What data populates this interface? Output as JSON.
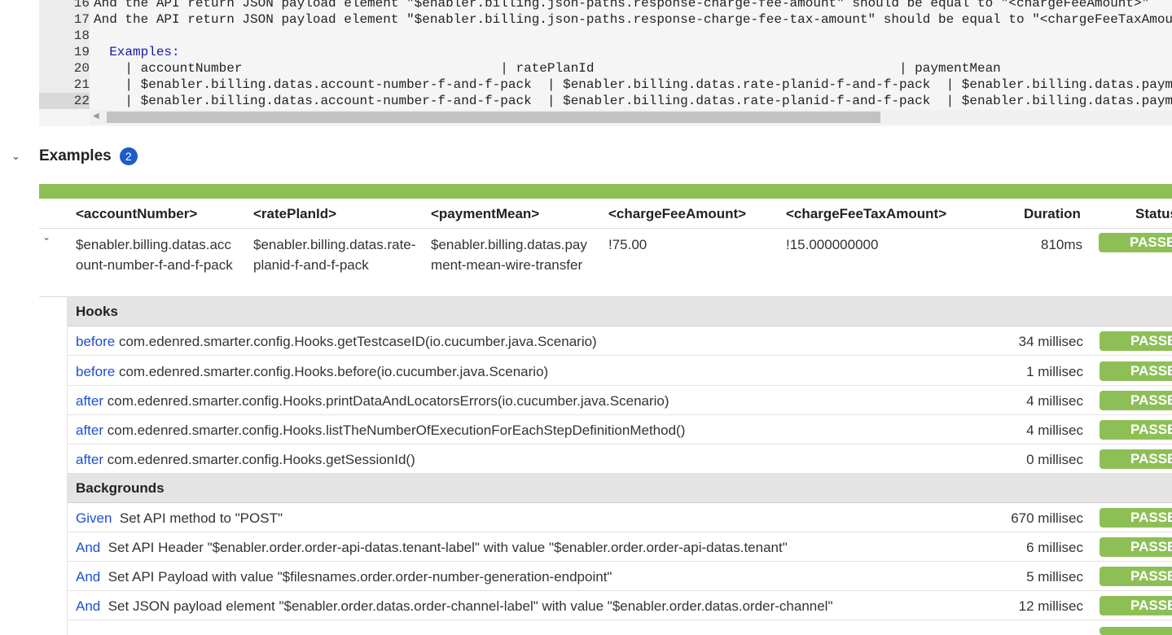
{
  "code": {
    "lines": [
      {
        "num": "16",
        "text": "And the API return JSON payload element \"$enabler.billing.json-paths.response-charge-fee-amount\" should be equal to \"<chargeFeeAmount>\""
      },
      {
        "num": "17",
        "text": "And the API return JSON payload element \"$enabler.billing.json-paths.response-charge-fee-tax-amount\" should be equal to \"<chargeFeeTaxAmount>\""
      },
      {
        "num": "18",
        "text": ""
      },
      {
        "num": "19",
        "text": "  Examples:"
      },
      {
        "num": "20",
        "text": "    | accountNumber                                 | ratePlanId                                       | paymentMean"
      },
      {
        "num": "21",
        "text": "    | $enabler.billing.datas.account-number-f-and-f-pack  | $enabler.billing.datas.rate-planid-f-and-f-pack  | $enabler.billing.datas.payment-mean-wire-transfer"
      },
      {
        "num": "22",
        "text": "    | $enabler.billing.datas.account-number-f-and-f-pack  | $enabler.billing.datas.rate-planid-f-and-f-pack  | $enabler.billing.datas.payment-mean-wire-transfer"
      }
    ]
  },
  "examples": {
    "title": "Examples",
    "count": "2",
    "headers": [
      "<accountNumber>",
      "<ratePlanId>",
      "<paymentMean>",
      "<chargeFeeAmount>",
      "<chargeFeeTaxAmount>",
      "Duration",
      "Status"
    ],
    "row": {
      "accountNumber": "$enabler.billing.datas.account-number-f-and-f-pack",
      "ratePlanId": "$enabler.billing.datas.rate-planid-f-and-f-pack",
      "paymentMean": "$enabler.billing.datas.payment-mean-wire-transfer",
      "chargeFeeAmount": "!75.00",
      "chargeFeeTaxAmount": "!15.000000000",
      "duration": "810ms",
      "status": "PASSED"
    }
  },
  "hooks": {
    "title": "Hooks",
    "items": [
      {
        "keyword": "before",
        "text": "com.edenred.smarter.config.Hooks.getTestcaseID(io.cucumber.java.Scenario)",
        "duration": "34 millisec",
        "status": "PASSED"
      },
      {
        "keyword": "before",
        "text": "com.edenred.smarter.config.Hooks.before(io.cucumber.java.Scenario)",
        "duration": "1 millisec",
        "status": "PASSED"
      },
      {
        "keyword": "after",
        "text": "com.edenred.smarter.config.Hooks.printDataAndLocatorsErrors(io.cucumber.java.Scenario)",
        "duration": "4 millisec",
        "status": "PASSED"
      },
      {
        "keyword": "after",
        "text": "com.edenred.smarter.config.Hooks.listTheNumberOfExecutionForEachStepDefinitionMethod()",
        "duration": "4 millisec",
        "status": "PASSED"
      },
      {
        "keyword": "after",
        "text": "com.edenred.smarter.config.Hooks.getSessionId()",
        "duration": "0 millisec",
        "status": "PASSED"
      }
    ]
  },
  "backgrounds": {
    "title": "Backgrounds",
    "items": [
      {
        "keyword": "Given",
        "text": "Set API method to \"POST\"",
        "duration": "670 millisec",
        "status": "PASSED"
      },
      {
        "keyword": "And",
        "text": "Set API Header \"$enabler.order.order-api-datas.tenant-label\" with value \"$enabler.order.order-api-datas.tenant\"",
        "duration": "6 millisec",
        "status": "PASSED"
      },
      {
        "keyword": "And",
        "text": "Set API Payload with value \"$filesnames.order.order-number-generation-endpoint\"",
        "duration": "5 millisec",
        "status": "PASSED"
      },
      {
        "keyword": "And",
        "text": "Set JSON payload element \"$enabler.order.datas.order-channel-label\" with value \"$enabler.order.datas.order-channel\"",
        "duration": "12 millisec",
        "status": "PASSED"
      }
    ]
  }
}
